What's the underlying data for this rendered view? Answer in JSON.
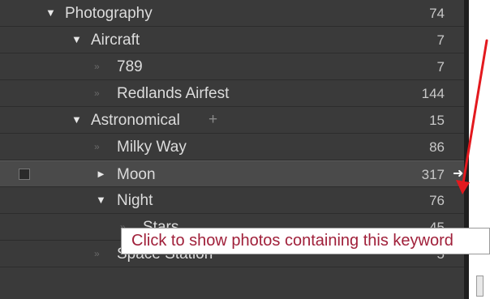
{
  "keyword_list": {
    "rows": [
      {
        "label": "Photography",
        "count": "74",
        "tri": "▼"
      },
      {
        "label": "Aircraft",
        "count": "7",
        "tri": "▼"
      },
      {
        "label": "789",
        "count": "7",
        "tri": "»"
      },
      {
        "label": "Redlands Airfest",
        "count": "144",
        "tri": "»"
      },
      {
        "label": "Astronomical",
        "count": "15",
        "tri": "▼",
        "plus": "+"
      },
      {
        "label": "Milky Way",
        "count": "86",
        "tri": "»"
      },
      {
        "label": "Moon",
        "count": "317",
        "tri": "►",
        "arrow": "➜"
      },
      {
        "label": "Night",
        "count": "76",
        "tri": "▼"
      },
      {
        "label": "Stars",
        "count": "45",
        "tri": "»"
      },
      {
        "label": "Space Station",
        "count": "5",
        "tri": "»"
      }
    ]
  },
  "tooltip": {
    "text": "Click to show photos containing this keyword"
  },
  "annotation": {
    "color": "#e3191e"
  }
}
